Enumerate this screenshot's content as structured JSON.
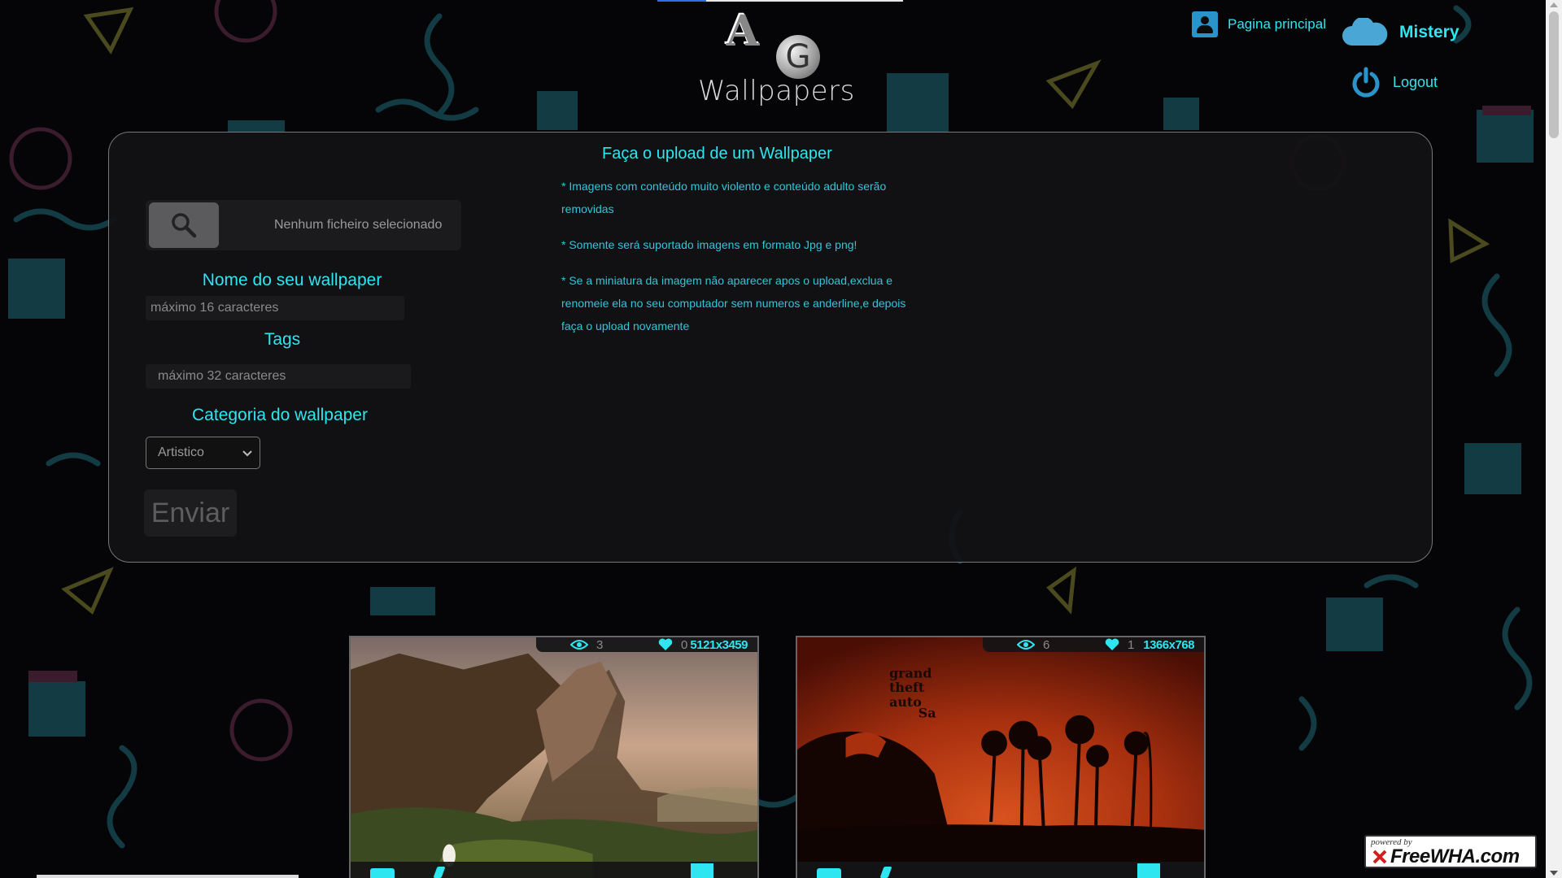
{
  "header": {
    "logo_text": "Wallpapers",
    "logo_letters": [
      "A",
      "G"
    ],
    "home_label": "Pagina principal",
    "user_name": "Mistery",
    "logout_label": "Logout"
  },
  "upload": {
    "title": "Faça o upload de um Wallpaper",
    "file_status": "Nenhum ficheiro selecionado",
    "name_label": "Nome do seu wallpaper",
    "name_placeholder": "máximo 16 caracteres",
    "tags_label": "Tags",
    "tags_placeholder": "máximo 32 caracteres",
    "category_label": "Categoria do wallpaper",
    "category_selected": "Artistico",
    "submit_label": "Enviar",
    "notes": [
      "* Imagens com conteúdo muito violento e conteúdo adulto serão removidas",
      "* Somente será suportado imagens em formato Jpg e png!",
      "* Se a miniatura da imagem não aparecer apos o upload,exclua e renomeie ela no seu computador sem numeros e anderline,e depois faça o upload novamente"
    ]
  },
  "wallpapers": [
    {
      "views": "3",
      "likes": "0",
      "resolution": "5121x3459"
    },
    {
      "views": "6",
      "likes": "1",
      "resolution": "1366x768"
    }
  ],
  "badge": {
    "powered_by": "powered by",
    "brand": "FreeWHA.com"
  },
  "colors": {
    "accent": "#2ee6f0",
    "panel_bg": "#121214",
    "page_bg": "#050507"
  }
}
